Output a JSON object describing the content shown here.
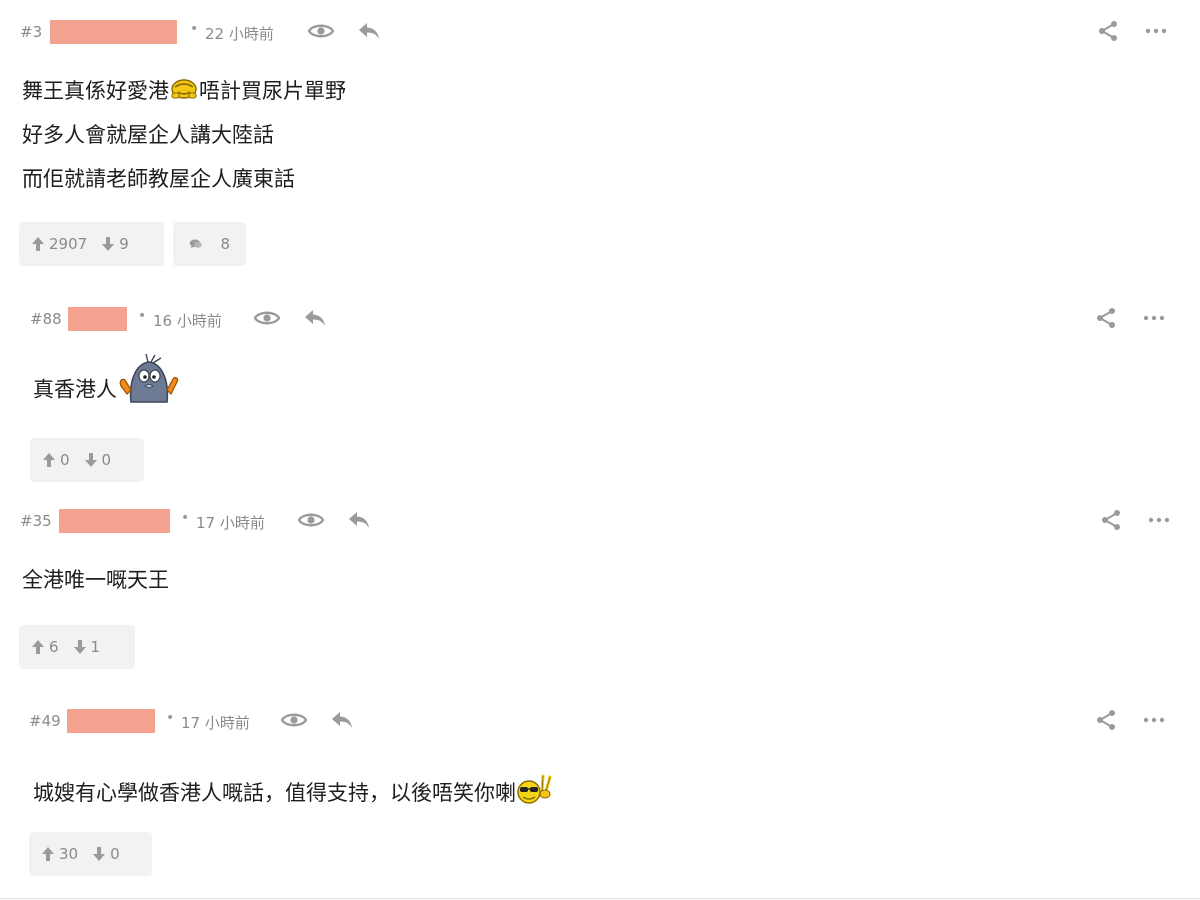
{
  "posts": [
    {
      "floor": "#3",
      "time": "22 小時前",
      "dot": "•",
      "lines": [
        "舞王真係好愛港",
        "唔計買尿片單野",
        "好多人會就屋企人講大陸話",
        "而佢就請老師教屋企人廣東話"
      ],
      "emoji": "bowing-emoji",
      "upvotes": "2907",
      "downvotes": "9",
      "replies": "8"
    },
    {
      "floor": "#88",
      "time": "16 小時前",
      "dot": "•",
      "lines": [
        "真香港人"
      ],
      "emoji": "cheering-creature-emoji",
      "upvotes": "0",
      "downvotes": "0"
    },
    {
      "floor": "#35",
      "time": "17 小時前",
      "dot": "•",
      "lines": [
        "全港唯一嘅天王"
      ],
      "upvotes": "6",
      "downvotes": "1"
    },
    {
      "floor": "#49",
      "time": "17 小時前",
      "dot": "•",
      "lines": [
        "城嫂有心學做香港人嘅話，值得支持，以後唔笑你喇"
      ],
      "emoji": "sunglasses-peace-emoji",
      "upvotes": "30",
      "downvotes": "0"
    }
  ],
  "icons": {
    "view": "eye-icon",
    "reply": "reply-arrow-icon",
    "share": "share-icon",
    "more": "more-dots-icon",
    "upvote": "arrow-up-icon",
    "downvote": "arrow-down-icon",
    "comments": "comment-bubble-icon"
  },
  "colors": {
    "name_redaction": "#f4a391",
    "meta_text": "#8a8a8a",
    "icon_grey": "#9a9a9a",
    "vote_box_bg": "#f2f2f2"
  }
}
